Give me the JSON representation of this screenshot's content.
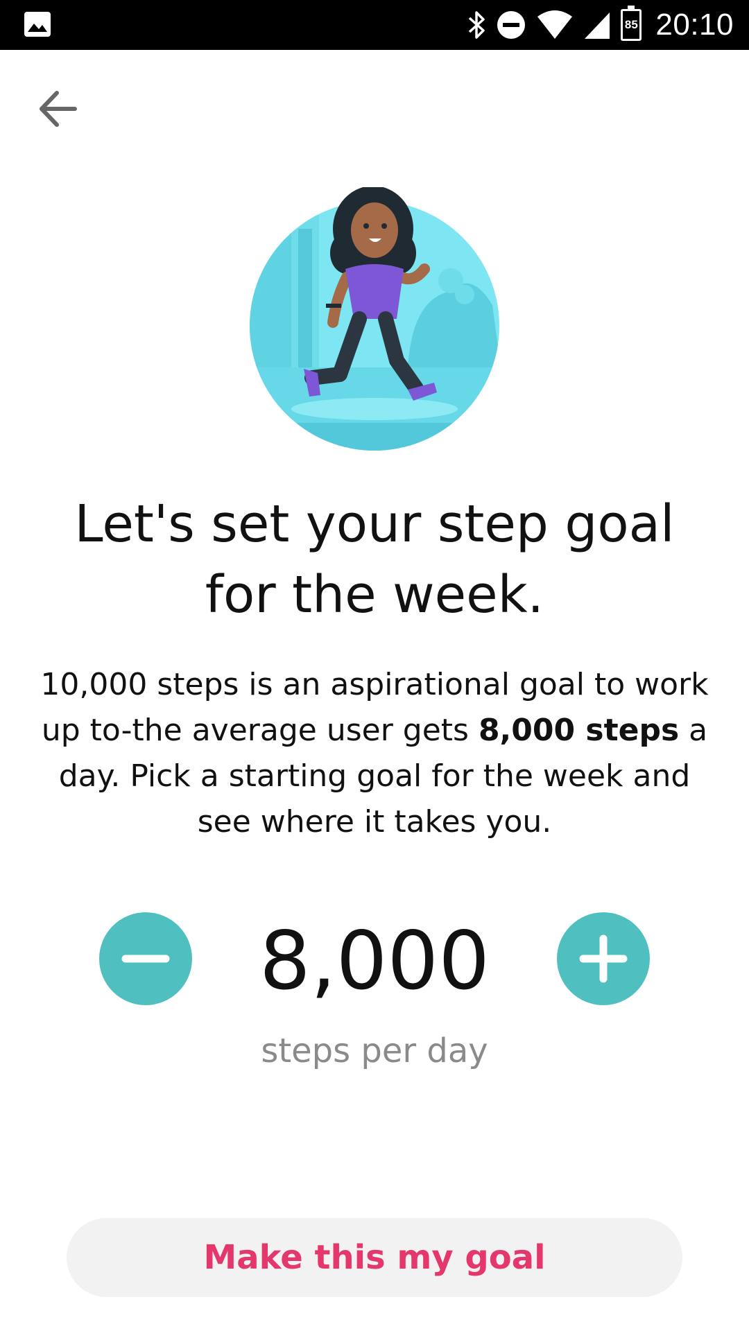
{
  "status_bar": {
    "time": "20:10",
    "battery_level": "85",
    "icons": [
      "image-icon",
      "bluetooth-icon",
      "do-not-disturb-icon",
      "wifi-icon",
      "signal-icon",
      "battery-icon"
    ]
  },
  "nav": {
    "back_icon": "arrow-left-icon"
  },
  "illustration": {
    "icon": "walking-person-illustration",
    "colors": {
      "circle": "#7ee6f2",
      "shirt": "#7e57d6",
      "skin": "#a56a48"
    }
  },
  "content": {
    "title_line1": "Let's set your step goal",
    "title_line2": "for the week.",
    "desc_part1": "10,000 steps is an aspirational goal to work up to-the average user gets ",
    "desc_bold1": "8,000 steps",
    "desc_part2": " a day. Pick a starting goal for the week and see where it takes you."
  },
  "stepper": {
    "value": "8,000",
    "unit": "steps per day",
    "minus_icon": "minus-icon",
    "plus_icon": "plus-icon",
    "accent_color": "#4fbfbf"
  },
  "actions": {
    "primary_label": "Make this my goal",
    "primary_color": "#e4386d"
  }
}
